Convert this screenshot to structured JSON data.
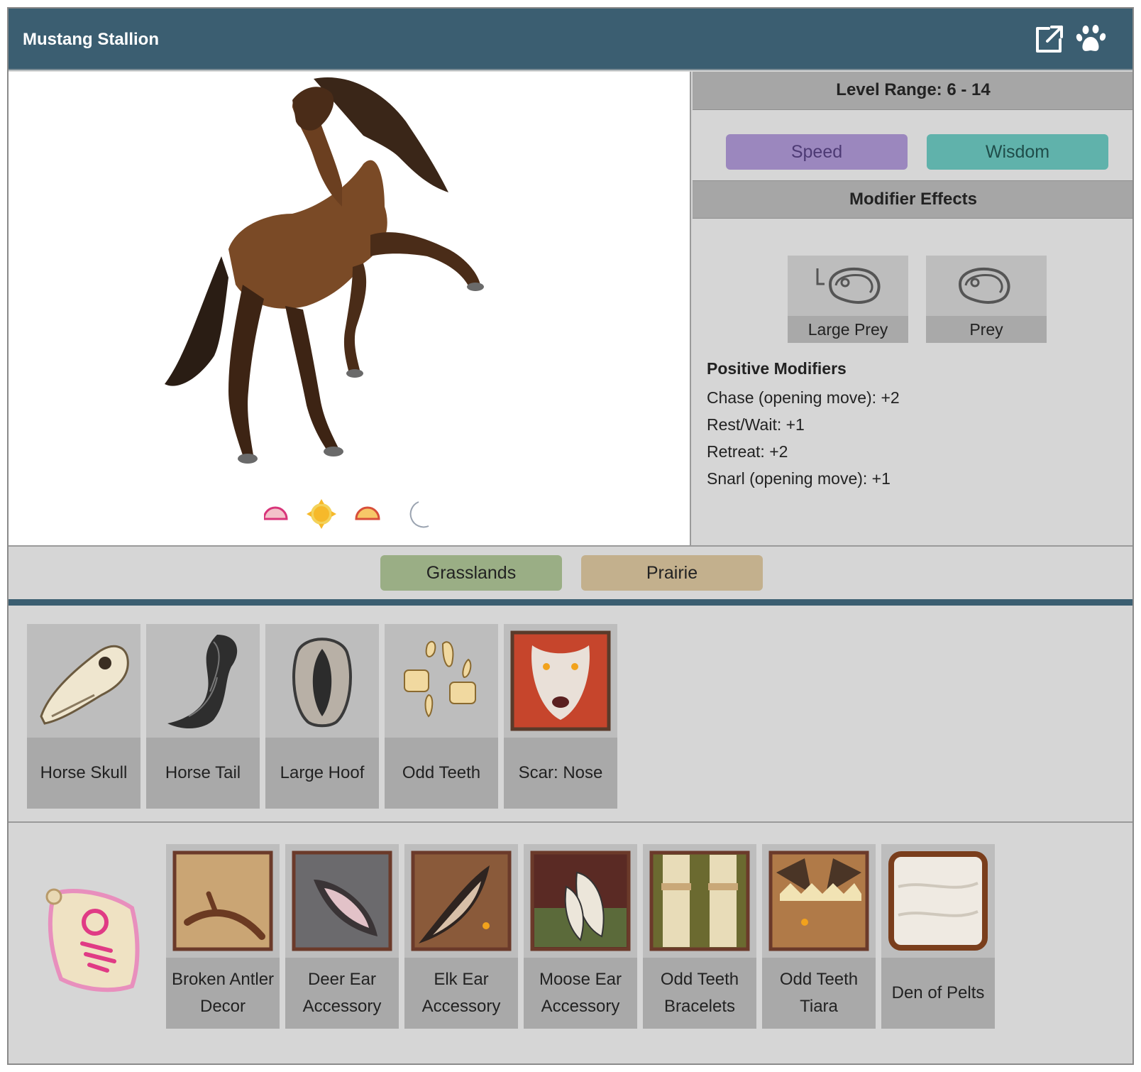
{
  "header": {
    "title": "Mustang Stallion",
    "icons": [
      "external-link-icon",
      "paw-icon"
    ],
    "color": "#3b5e71"
  },
  "time_icons": [
    "dawn-icon",
    "day-sun-icon",
    "dusk-icon",
    "night-moon-icon"
  ],
  "info": {
    "level_range": "Level Range: 6 - 14",
    "stats": [
      {
        "label": "Speed",
        "color": "#9b87be"
      },
      {
        "label": "Wisdom",
        "color": "#60b2ab"
      }
    ],
    "modifier_effects_title": "Modifier Effects",
    "prey": [
      {
        "label": "Large Prey",
        "icon": "large-prey-meat-icon"
      },
      {
        "label": "Prey",
        "icon": "prey-meat-icon"
      }
    ],
    "positive_modifiers_title": "Positive Modifiers",
    "positive_modifiers": [
      "Chase (opening move): +2",
      "Rest/Wait: +1",
      "Retreat: +2",
      "Snarl (opening move): +1"
    ]
  },
  "biomes": [
    {
      "label": "Grasslands",
      "color": "#9aae85"
    },
    {
      "label": "Prairie",
      "color": "#c3b08d"
    }
  ],
  "drops": [
    {
      "label": "Horse Skull",
      "icon": "horse-skull-icon"
    },
    {
      "label": "Horse Tail",
      "icon": "horse-tail-icon"
    },
    {
      "label": "Large Hoof",
      "icon": "large-hoof-icon"
    },
    {
      "label": "Odd Teeth",
      "icon": "odd-teeth-icon"
    },
    {
      "label": "Scar: Nose",
      "icon": "scar-nose-icon"
    }
  ],
  "decor": [
    {
      "label": "Broken Antler Decor",
      "icon": "broken-antler-decor-icon"
    },
    {
      "label": "Deer Ear Accessory",
      "icon": "deer-ear-accessory-icon"
    },
    {
      "label": "Elk Ear Accessory",
      "icon": "elk-ear-accessory-icon"
    },
    {
      "label": "Moose Ear Accessory",
      "icon": "moose-ear-accessory-icon"
    },
    {
      "label": "Odd Teeth Bracelets",
      "icon": "odd-teeth-bracelets-icon"
    },
    {
      "label": "Odd Teeth Tiara",
      "icon": "odd-teeth-tiara-icon"
    },
    {
      "label": "Den of Pelts",
      "icon": "den-of-pelts-icon"
    }
  ]
}
